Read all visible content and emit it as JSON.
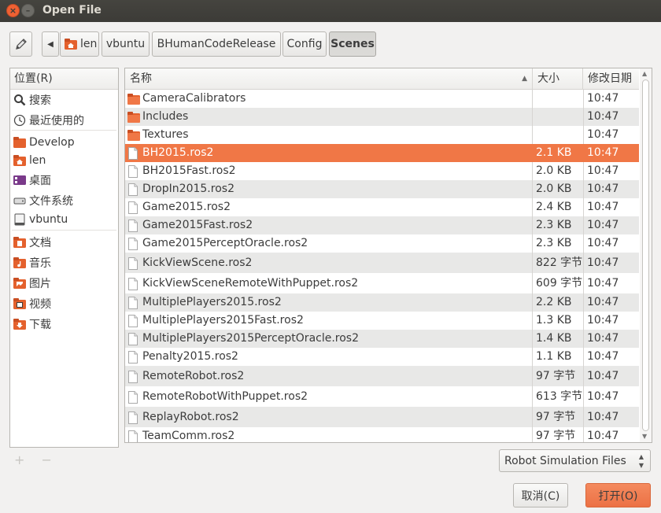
{
  "window": {
    "title": "Open File",
    "close_glyph": "×",
    "minimize_glyph": "–"
  },
  "pathbar": {
    "back_glyph": "◀",
    "crumbs": [
      "len",
      "vbuntu",
      "BHumanCodeRelease",
      "Config",
      "Scenes"
    ],
    "active_crumb": "Scenes"
  },
  "sidebar": {
    "header": "位置(R)",
    "items": [
      {
        "label": "搜索",
        "icon": "search-icon"
      },
      {
        "label": "最近使用的",
        "icon": "recent-clock-icon"
      },
      {
        "label": "Develop",
        "icon": "folder-icon"
      },
      {
        "label": "len",
        "icon": "home-folder-icon"
      },
      {
        "label": "桌面",
        "icon": "desktop-icon"
      },
      {
        "label": "文件系统",
        "icon": "drive-icon"
      },
      {
        "label": "vbuntu",
        "icon": "device-icon"
      },
      {
        "label": "文档",
        "icon": "documents-folder-icon"
      },
      {
        "label": "音乐",
        "icon": "music-folder-icon"
      },
      {
        "label": "图片",
        "icon": "pictures-folder-icon"
      },
      {
        "label": "视频",
        "icon": "videos-folder-icon"
      },
      {
        "label": "下载",
        "icon": "downloads-folder-icon"
      }
    ],
    "add_glyph": "+",
    "remove_glyph": "−"
  },
  "filelist": {
    "columns": {
      "name": "名称",
      "size": "大小",
      "modified": "修改日期"
    },
    "sort_glyph": "▲",
    "rows": [
      {
        "name": "CameraCalibrators",
        "size": "",
        "modified": "10:47",
        "type": "folder"
      },
      {
        "name": "Includes",
        "size": "",
        "modified": "10:47",
        "type": "folder"
      },
      {
        "name": "Textures",
        "size": "",
        "modified": "10:47",
        "type": "folder"
      },
      {
        "name": "BH2015.ros2",
        "size": "2.1 KB",
        "modified": "10:47",
        "type": "file",
        "selected": true
      },
      {
        "name": "BH2015Fast.ros2",
        "size": "2.0 KB",
        "modified": "10:47",
        "type": "file"
      },
      {
        "name": "DropIn2015.ros2",
        "size": "2.0 KB",
        "modified": "10:47",
        "type": "file"
      },
      {
        "name": "Game2015.ros2",
        "size": "2.4 KB",
        "modified": "10:47",
        "type": "file"
      },
      {
        "name": "Game2015Fast.ros2",
        "size": "2.3 KB",
        "modified": "10:47",
        "type": "file"
      },
      {
        "name": "Game2015PerceptOracle.ros2",
        "size": "2.3 KB",
        "modified": "10:47",
        "type": "file"
      },
      {
        "name": "KickViewScene.ros2",
        "size": "822 字节",
        "modified": "10:47",
        "type": "file"
      },
      {
        "name": "KickViewSceneRemoteWithPuppet.ros2",
        "size": "609 字节",
        "modified": "10:47",
        "type": "file"
      },
      {
        "name": "MultiplePlayers2015.ros2",
        "size": "2.2 KB",
        "modified": "10:47",
        "type": "file"
      },
      {
        "name": "MultiplePlayers2015Fast.ros2",
        "size": "1.3 KB",
        "modified": "10:47",
        "type": "file"
      },
      {
        "name": "MultiplePlayers2015PerceptOracle.ros2",
        "size": "1.4 KB",
        "modified": "10:47",
        "type": "file"
      },
      {
        "name": "Penalty2015.ros2",
        "size": "1.1 KB",
        "modified": "10:47",
        "type": "file"
      },
      {
        "name": "RemoteRobot.ros2",
        "size": "97 字节",
        "modified": "10:47",
        "type": "file"
      },
      {
        "name": "RemoteRobotWithPuppet.ros2",
        "size": "613 字节",
        "modified": "10:47",
        "type": "file"
      },
      {
        "name": "ReplayRobot.ros2",
        "size": "97 字节",
        "modified": "10:47",
        "type": "file"
      },
      {
        "name": "TeamComm.ros2",
        "size": "97 字节",
        "modified": "10:47",
        "type": "file"
      }
    ]
  },
  "scrollbar": {
    "up_glyph": "▲",
    "down_glyph": "▼"
  },
  "filter": {
    "value": "Robot Simulation Files",
    "updown_glyph": "▲▼"
  },
  "actions": {
    "cancel": "取消(C)",
    "open": "打开(O)"
  },
  "colors": {
    "selection": "#f07746",
    "titlebar": "#3c3b37",
    "accent": "#ef6133"
  }
}
